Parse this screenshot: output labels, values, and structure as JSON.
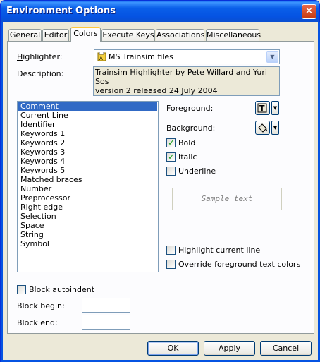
{
  "window": {
    "title": "Environment Options",
    "close_glyph": "✕"
  },
  "tabs": [
    {
      "label": "General",
      "active": false
    },
    {
      "label": "Editor",
      "active": false
    },
    {
      "label": "Colors",
      "active": true
    },
    {
      "label": "Execute Keys",
      "active": false
    },
    {
      "label": "Associations",
      "active": false
    },
    {
      "label": "Miscellaneous",
      "active": false
    }
  ],
  "highlighter": {
    "label": "Highlighter:",
    "value": "MS Trainsim files",
    "icon": "highlighter-file-icon"
  },
  "description": {
    "label": "Description:",
    "text_line1": "Trainsim Highlighter by Pete Willard and Yuri Sos",
    "text_line2": "version 2 released 24 July 2004"
  },
  "elements": {
    "items": [
      "Comment",
      "Current Line",
      "Identifier",
      "Keywords 1",
      "Keywords 2",
      "Keywords 3",
      "Keywords 4",
      "Keywords 5",
      "Matched braces",
      "Number",
      "Preprocessor",
      "Right edge",
      "Selection",
      "Space",
      "String",
      "Symbol"
    ],
    "selected": "Comment"
  },
  "foreground": {
    "label": "Foreground:"
  },
  "background": {
    "label": "Background:"
  },
  "bold": {
    "label": "Bold",
    "checked": true
  },
  "italic": {
    "label": "Italic",
    "checked": true
  },
  "underline": {
    "label": "Underline",
    "checked": false
  },
  "sample": {
    "text": "Sample text"
  },
  "highlight_current_line": {
    "label": "Highlight current line",
    "checked": false
  },
  "override_fg": {
    "label": "Override foreground text colors",
    "checked": false
  },
  "block_autoindent": {
    "label": "Block autoindent",
    "checked": false
  },
  "block_begin": {
    "label": "Block begin:",
    "value": ""
  },
  "block_end": {
    "label": "Block end:",
    "value": ""
  },
  "buttons": {
    "ok": "OK",
    "apply": "Apply",
    "cancel": "Cancel"
  },
  "colors": {
    "title_bar": "#0553E2",
    "selection": "#316AC5",
    "face": "#ECE9D8",
    "check": "#21A121"
  }
}
